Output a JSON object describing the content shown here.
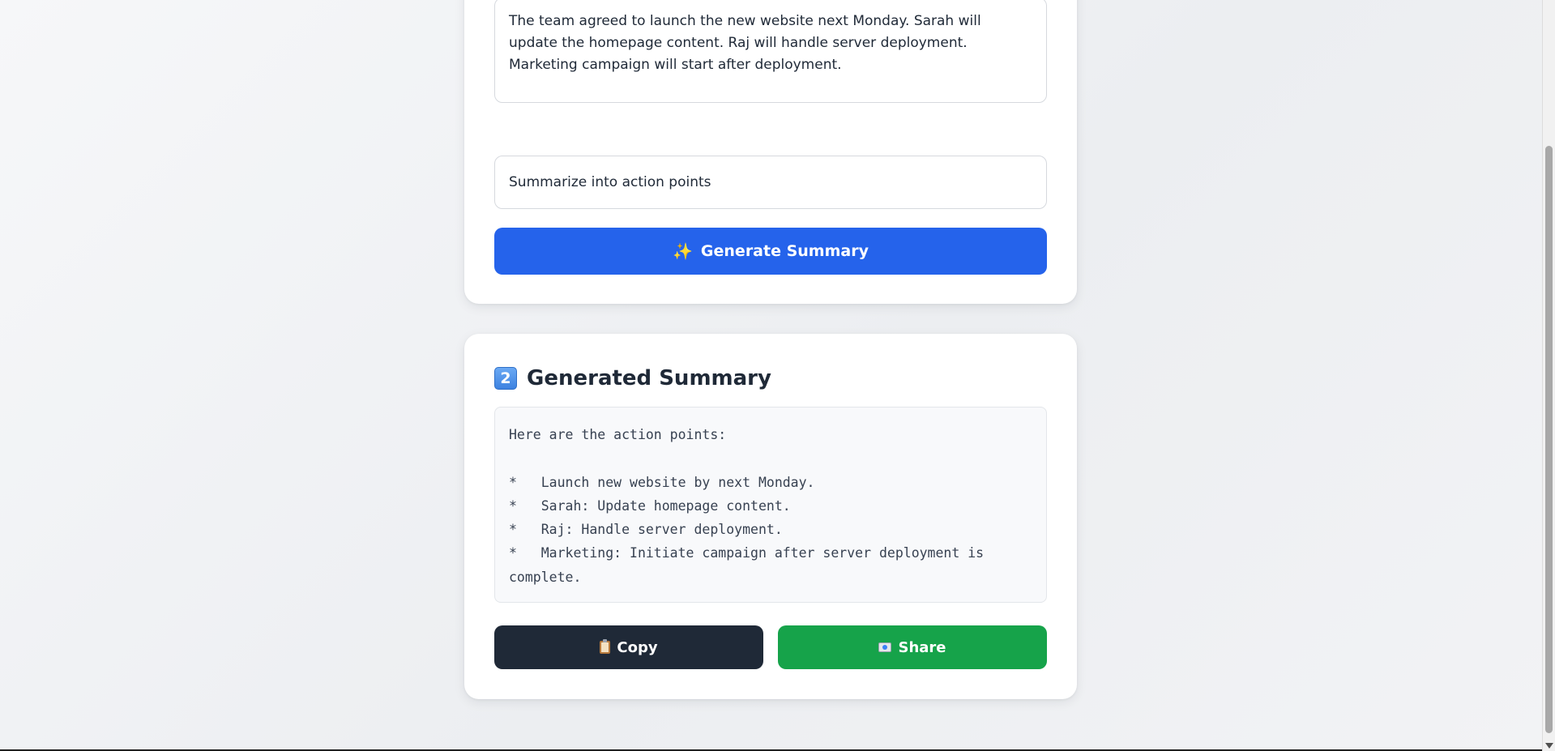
{
  "input_card": {
    "notes_text": "The team agreed to launch the new website next Monday. Sarah will update the homepage content. Raj will handle server deployment. Marketing campaign will start after deployment.",
    "instruction_value": "Summarize into action points",
    "generate_button": {
      "icon": "sparkles-icon",
      "label": "Generate Summary"
    }
  },
  "output_card": {
    "step_number": "2",
    "title": "Generated Summary",
    "summary_text": "Here are the action points:\n\n*   Launch new website by next Monday.\n*   Sarah: Update homepage content.\n*   Raj: Handle server deployment.\n*   Marketing: Initiate campaign after server deployment is complete.",
    "copy_button": {
      "icon": "clipboard-icon",
      "label": "Copy"
    },
    "share_button": {
      "icon": "envelope-icon",
      "label": "Share"
    }
  },
  "colors": {
    "primary": "#2563eb",
    "dark": "#1f2937",
    "success": "#16a34a",
    "background": "#f3f4f6"
  }
}
